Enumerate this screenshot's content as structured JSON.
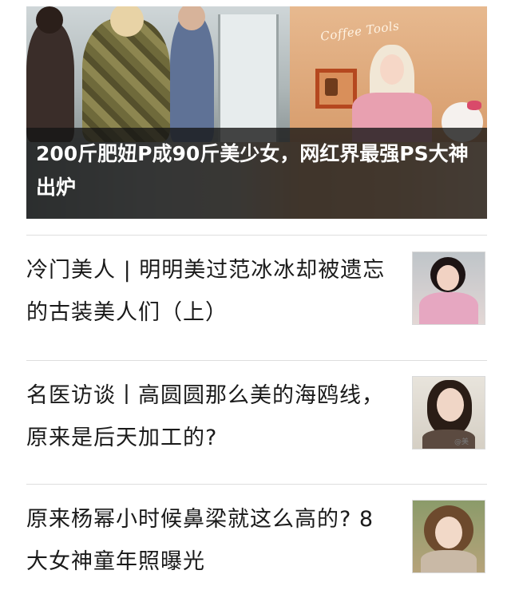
{
  "hero": {
    "title": "200斤肥妞P成90斤美少女，网红界最强PS大神出炉",
    "image_sign_text": "Coffee Tools"
  },
  "news_list": [
    {
      "title": "冷门美人 | 明明美过范冰冰却被遗忘的古装美人们（上）"
    },
    {
      "title": "名医访谈丨高圆圆那么美的海鸥线，原来是后天加工的?",
      "thumb_watermark": "@美"
    },
    {
      "title": "原来杨幂小时候鼻梁就这么高的? 8大女神童年照曝光"
    }
  ],
  "colors": {
    "caption_overlay": "#141414",
    "divider": "#dedede",
    "title_text": "#1a1a1a",
    "caption_text": "#ffffff"
  }
}
